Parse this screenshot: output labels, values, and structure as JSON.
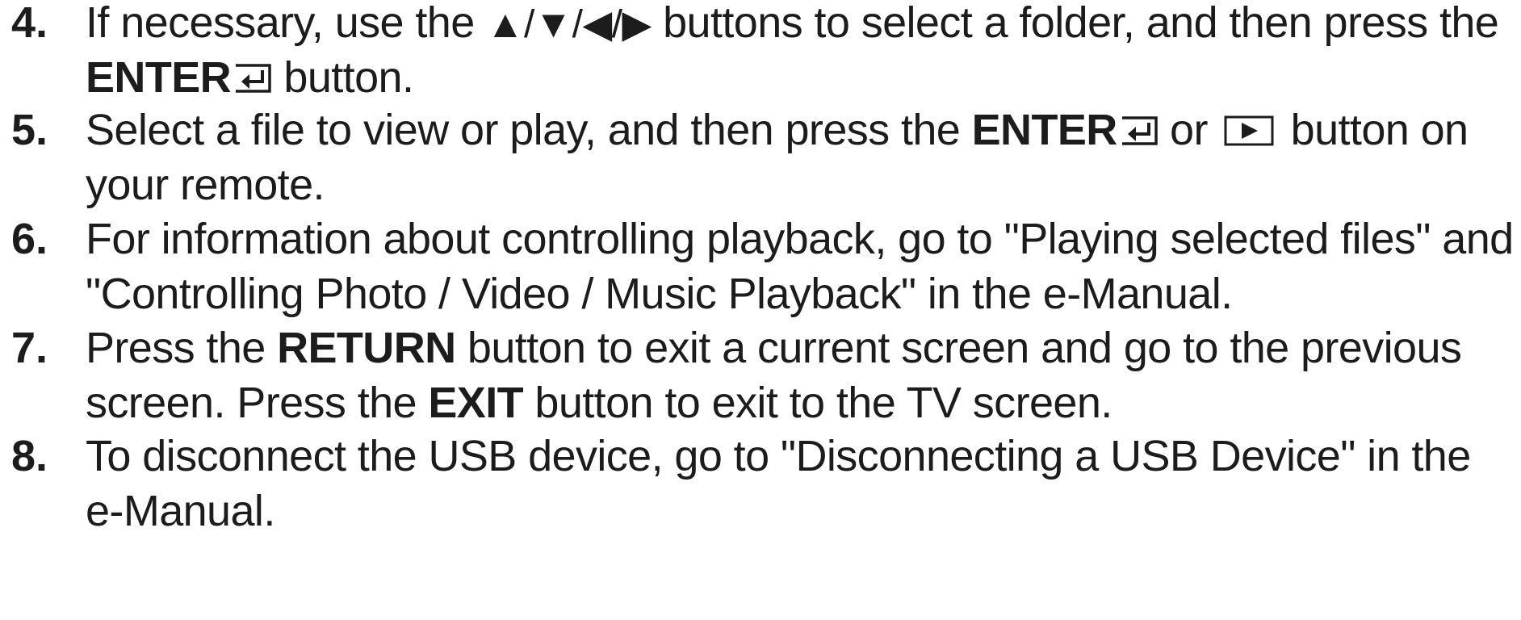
{
  "steps": [
    {
      "number": "4.",
      "line1_a": "If necessary, use the ",
      "arrows": "▲/▼/◀/▶",
      "line1_b": " buttons to select a folder, and then press the",
      "line2_bold": "ENTER",
      "line2_rest": " button."
    },
    {
      "number": "5.",
      "line1_a": "Select a file to view or play, and then press the ",
      "line1_bold": "ENTER",
      "line1_mid": " or ",
      "line1_b": " button on",
      "line2": "your remote."
    },
    {
      "number": "6.",
      "line1": "For information about controlling playback, go to \"Playing selected files\" and",
      "line2": "\"Controlling Photo / Video / Music Playback\" in the e-Manual."
    },
    {
      "number": "7.",
      "line1_a": "Press the ",
      "line1_bold": "RETURN",
      "line1_b": " button to exit a current screen and go to the previous",
      "line2_a": "screen. Press the ",
      "line2_bold": "EXIT",
      "line2_b": " button to exit to the TV screen."
    },
    {
      "number": "8.",
      "line1": "To disconnect the USB device, go to \"Disconnecting a USB Device\" in the",
      "line2": "e-Manual."
    }
  ]
}
